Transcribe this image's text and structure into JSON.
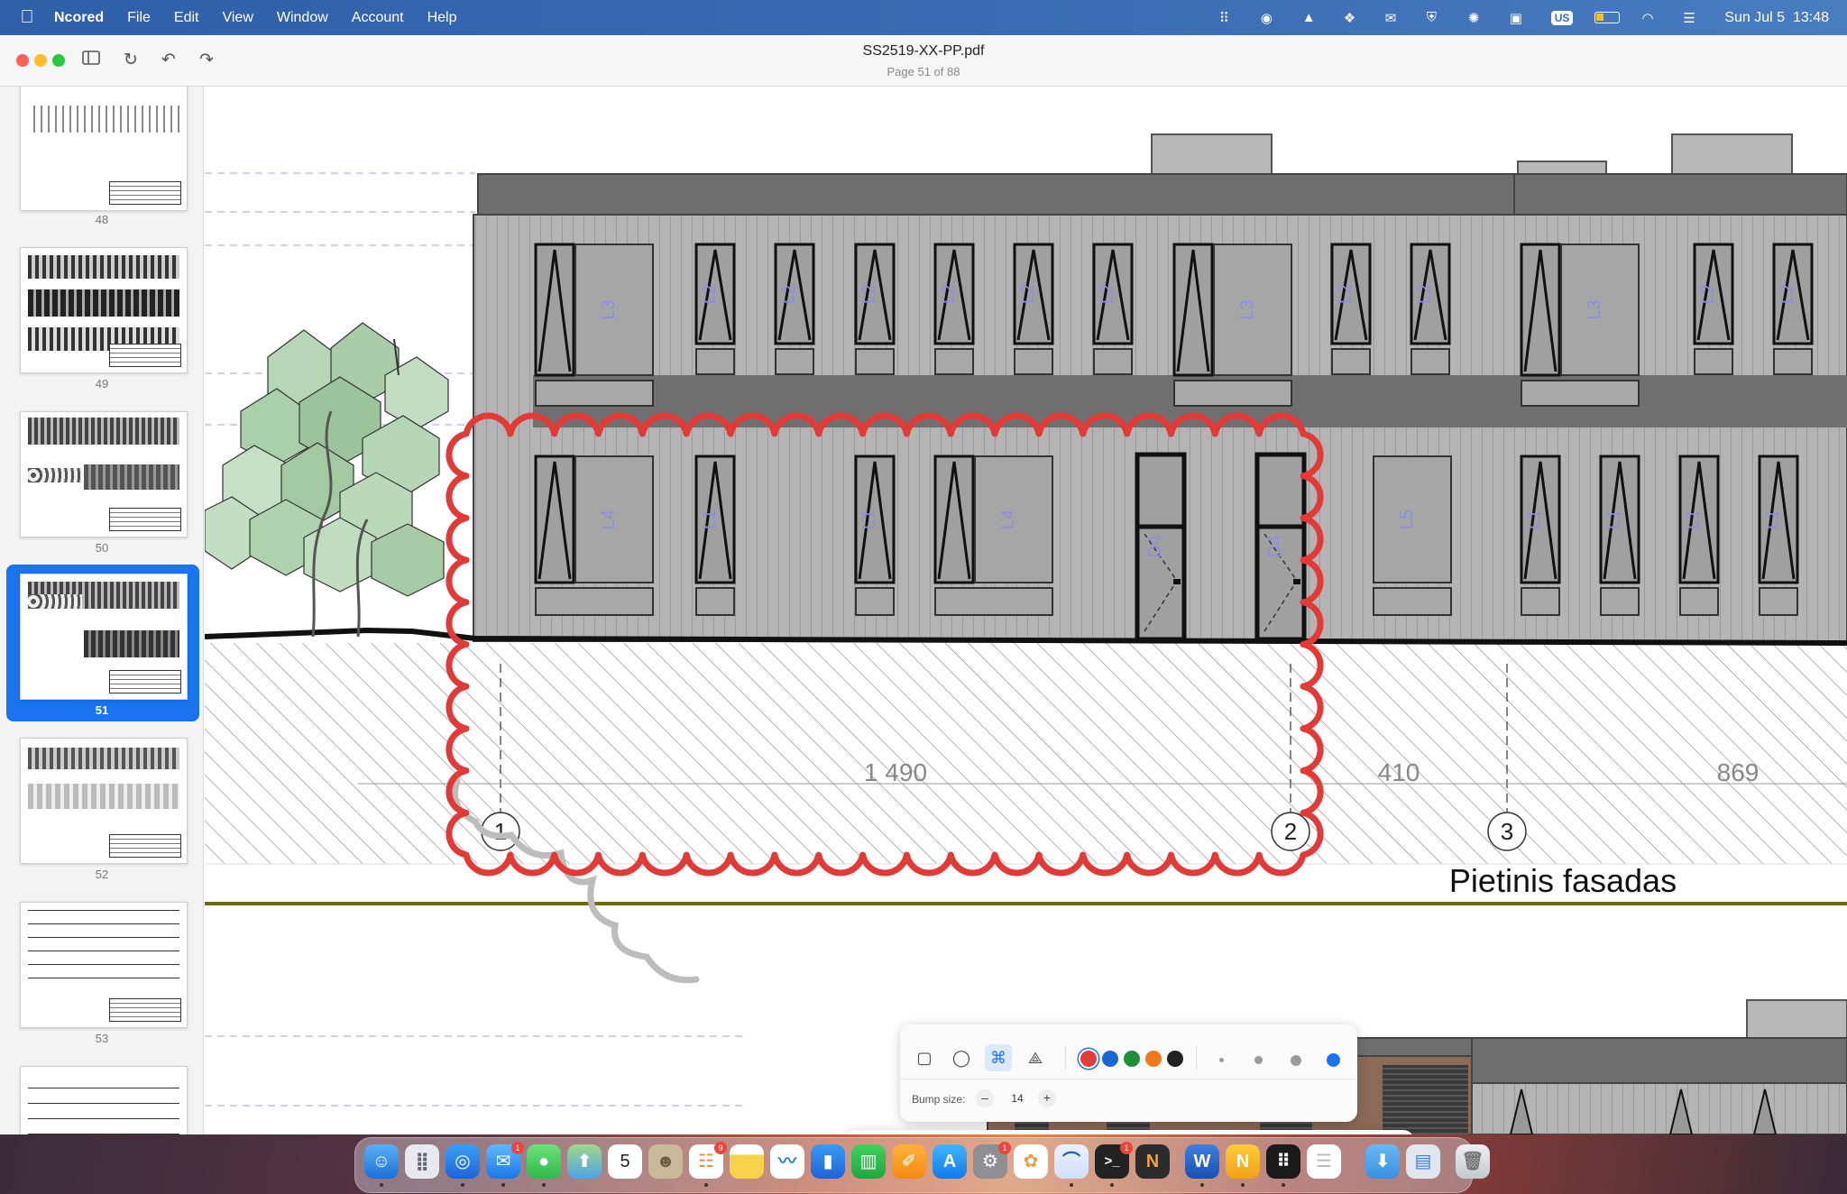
{
  "menubar": {
    "app_name": "Ncored",
    "items": [
      "File",
      "Edit",
      "View",
      "Window",
      "Account",
      "Help"
    ],
    "input_source": "US",
    "datetime": "Sun Jul 5  13:48"
  },
  "document": {
    "filename": "SS2519-XX-PP.pdf",
    "page_info": "Page 51 of 88"
  },
  "sidebar": {
    "pages": [
      "48",
      "49",
      "50",
      "51",
      "52",
      "53"
    ],
    "selected": "51"
  },
  "drawing": {
    "dim_1": "1 490",
    "dim_2": "410",
    "dim_3": "869",
    "axis_1": "1",
    "axis_2": "2",
    "axis_3": "3",
    "caption": "Pietinis fasadas",
    "window_tags": [
      "L3",
      "L2",
      "L2",
      "L2",
      "L2",
      "L2",
      "L2",
      "L3",
      "L2",
      "L2",
      "L3",
      "L2",
      "L2",
      "L4",
      "L1",
      "L1",
      "L4",
      "D4",
      "D4",
      "L5",
      "L1",
      "L1",
      "L1",
      "L1"
    ]
  },
  "annotation_toolbar": {
    "bump_label": "Bump size:",
    "bump_value": "14",
    "minus": "–",
    "plus": "+",
    "colors": [
      "#e23b3b",
      "#1a66d6",
      "#1e8f3a",
      "#f07a1a",
      "#222222"
    ],
    "selected_color": "#e23b3b",
    "cloud_color": "#e23a36"
  },
  "dock": {
    "mail_badge": "1",
    "reminders_badge": "9",
    "settings_badge": "1",
    "terminal_badge": "1",
    "calendar_day": "5"
  }
}
